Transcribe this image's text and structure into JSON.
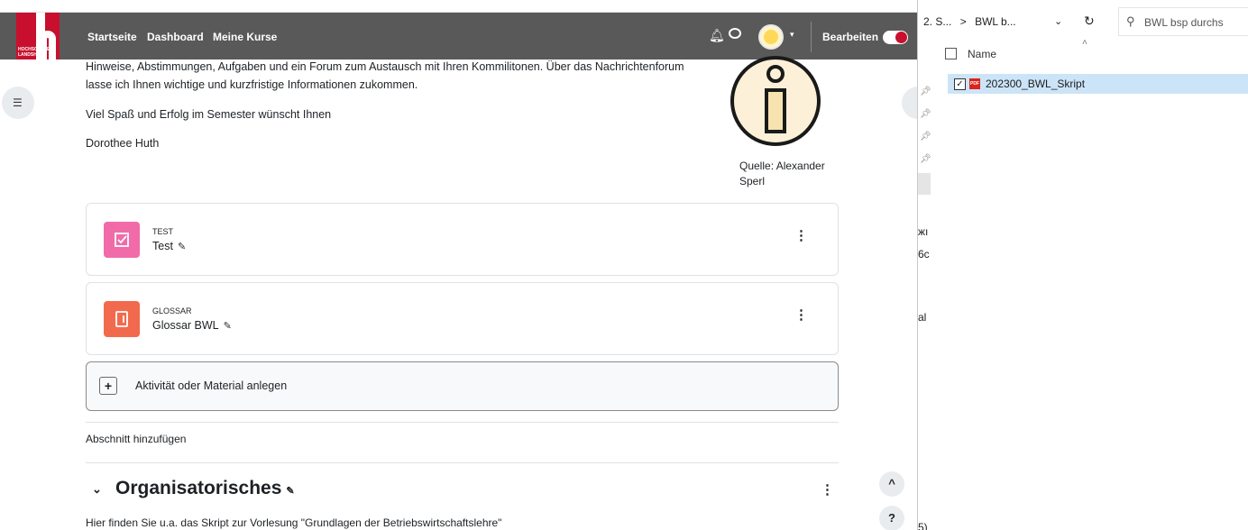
{
  "moodle": {
    "logo": {
      "text": "HOCHSCHULE LANDSHUT",
      "brand_color": "#c8102e"
    },
    "nav": {
      "links": [
        "Startseite",
        "Dashboard",
        "Meine Kurse"
      ],
      "edit_label": "Bearbeiten",
      "icons": [
        "bell-icon",
        "chat-icon"
      ]
    },
    "content": {
      "intro_line1": "Hinweise, Abstimmungen, Aufgaben und ein Forum zum Austausch mit Ihren Kommilitonen. Über das Nachrichtenforum",
      "intro_line2": "lasse ich Ihnen wichtige und kurzfristige Informationen zukommen.",
      "greeting": "Viel Spaß und Erfolg im Semester wünscht Ihnen",
      "author": "Dorothee Huth",
      "image_caption_line1": "Quelle: Alexander",
      "image_caption_line2": "Sperl"
    },
    "activities": [
      {
        "type": "TEST",
        "name": "Test",
        "color": "#f06ba8"
      },
      {
        "type": "GLOSSAR",
        "name": "Glossar BWL",
        "color": "#f26a4d"
      }
    ],
    "add_activity_label": "Aktivität oder Material anlegen",
    "add_section_label": "Abschnitt hinzufügen",
    "section": {
      "title": "Organisatorisches",
      "description": "Hier finden Sie u.a. das Skript zur Vorlesung \"Grundlagen der Betriebswirtschaftslehre\""
    },
    "float_buttons": {
      "up": "^",
      "help": "?"
    }
  },
  "explorer": {
    "breadcrumb_1": "2. S...",
    "breadcrumb_sep": ">",
    "breadcrumb_2": "BWL b...",
    "search_placeholder": "BWL bsp durchs",
    "column_name": "Name",
    "file": {
      "name": "202300_BWL_Skript",
      "checked": true,
      "icon_text": "PDF"
    },
    "fragments": [
      "жı",
      "6c",
      "al",
      "5)"
    ]
  }
}
